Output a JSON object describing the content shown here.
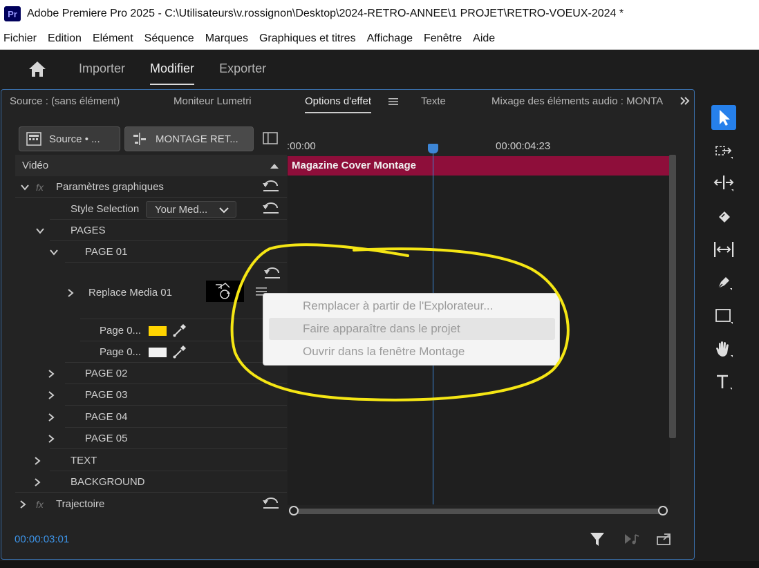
{
  "app": {
    "logo_text": "Pr",
    "title": "Adobe Premiere Pro 2025 - C:\\Utilisateurs\\v.rossignon\\Desktop\\2024-RETRO-ANNEE\\1 PROJET\\RETRO-VOEUX-2024 *"
  },
  "menu": [
    "Fichier",
    "Edition",
    "Elément",
    "Séquence",
    "Marques",
    "Graphiques et titres",
    "Affichage",
    "Fenêtre",
    "Aide"
  ],
  "workspace_tabs": [
    {
      "label": "Importer",
      "active": false
    },
    {
      "label": "Modifier",
      "active": true
    },
    {
      "label": "Exporter",
      "active": false
    }
  ],
  "panel_tabs": {
    "source": "Source : (sans élément)",
    "lumetri": "Moniteur Lumetri",
    "effect_options": "Options d'effet",
    "text": "Texte",
    "audio_mixer": "Mixage des éléments audio : MONTA"
  },
  "source_selector": {
    "source_label": "Source • ...",
    "sequence_label": "MONTAGE RET..."
  },
  "effect_tree": {
    "video_header": "Vidéo",
    "graphic_params": "Paramètres graphiques",
    "style_selection_label": "Style Selection",
    "style_selection_value": "Your Med...",
    "pages": "PAGES",
    "page01": "PAGE 01",
    "replace_media": "Replace Media 01",
    "page_color_1": "Page 0...",
    "page_color_2": "Page 0...",
    "page02": "PAGE 02",
    "page03": "PAGE 03",
    "page04": "PAGE 04",
    "page05": "PAGE 05",
    "text": "TEXT",
    "background": "BACKGROUND",
    "trajectory": "Trajectoire"
  },
  "colors": {
    "swatch_yellow": "#ffd400",
    "swatch_white": "#f2f2f2",
    "clip": "#8e0e3a",
    "accent": "#2680eb"
  },
  "timeline": {
    "start_time": ":00:00",
    "end_time": "00:00:04:23",
    "clip_name": "Magazine Cover Montage",
    "current_time": "00:00:03:01"
  },
  "context_menu": {
    "items": [
      "Remplacer à partir de l'Explorateur...",
      "Faire apparaître dans le projet",
      "Ouvrir dans la fenêtre Montage"
    ],
    "highlighted_index": 1
  },
  "tools": [
    "selection-tool-icon",
    "track-select-icon",
    "ripple-edit-icon",
    "razor-icon",
    "slip-icon",
    "pen-icon",
    "rectangle-icon",
    "hand-icon",
    "type-icon"
  ]
}
